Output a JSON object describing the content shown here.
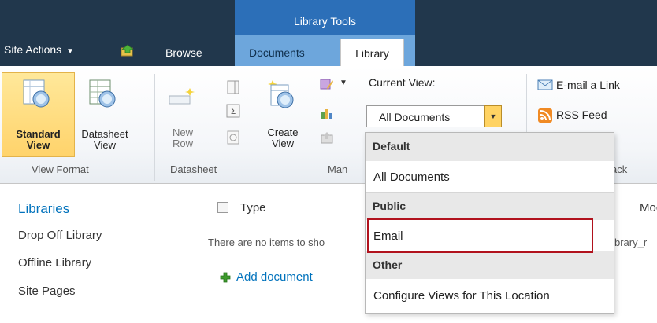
{
  "topbar": {
    "site_actions": "Site Actions",
    "tab_browse": "Browse",
    "contextual_group": "Library Tools",
    "tab_documents": "Documents",
    "tab_library": "Library"
  },
  "ribbon": {
    "groups": {
      "view_format": "View Format",
      "datasheet": "Datasheet",
      "manage_views": "Man",
      "share_track": "ack"
    },
    "standard_view": [
      "Standard",
      "View"
    ],
    "datasheet_view": [
      "Datasheet",
      "View"
    ],
    "new_row": [
      "New",
      "Row"
    ],
    "create_view": [
      "Create",
      "View"
    ],
    "current_view_label": "Current View:",
    "current_view_value": "All Documents",
    "email_link": "E-mail a Link",
    "rss_feed": "RSS Feed"
  },
  "sidebar": {
    "heading": "Libraries",
    "items": [
      "Drop Off Library",
      "Offline Library",
      "Site Pages"
    ]
  },
  "list": {
    "col_type": "Type",
    "col_modified": "Moc",
    "empty_message": "There are no items to sho",
    "empty_tail": "brary_r",
    "add_document": "Add document"
  },
  "dropdown": {
    "sections": [
      {
        "header": "Default",
        "items": [
          "All Documents"
        ]
      },
      {
        "header": "Public",
        "items": [
          "Email"
        ]
      },
      {
        "header": "Other",
        "items": [
          "Configure Views for This Location"
        ]
      }
    ]
  },
  "colors": {
    "topbar": "#21374c",
    "contextual_tab": "#2c6fb8",
    "link_blue": "#0072bc",
    "highlight_border": "#b1121d"
  }
}
